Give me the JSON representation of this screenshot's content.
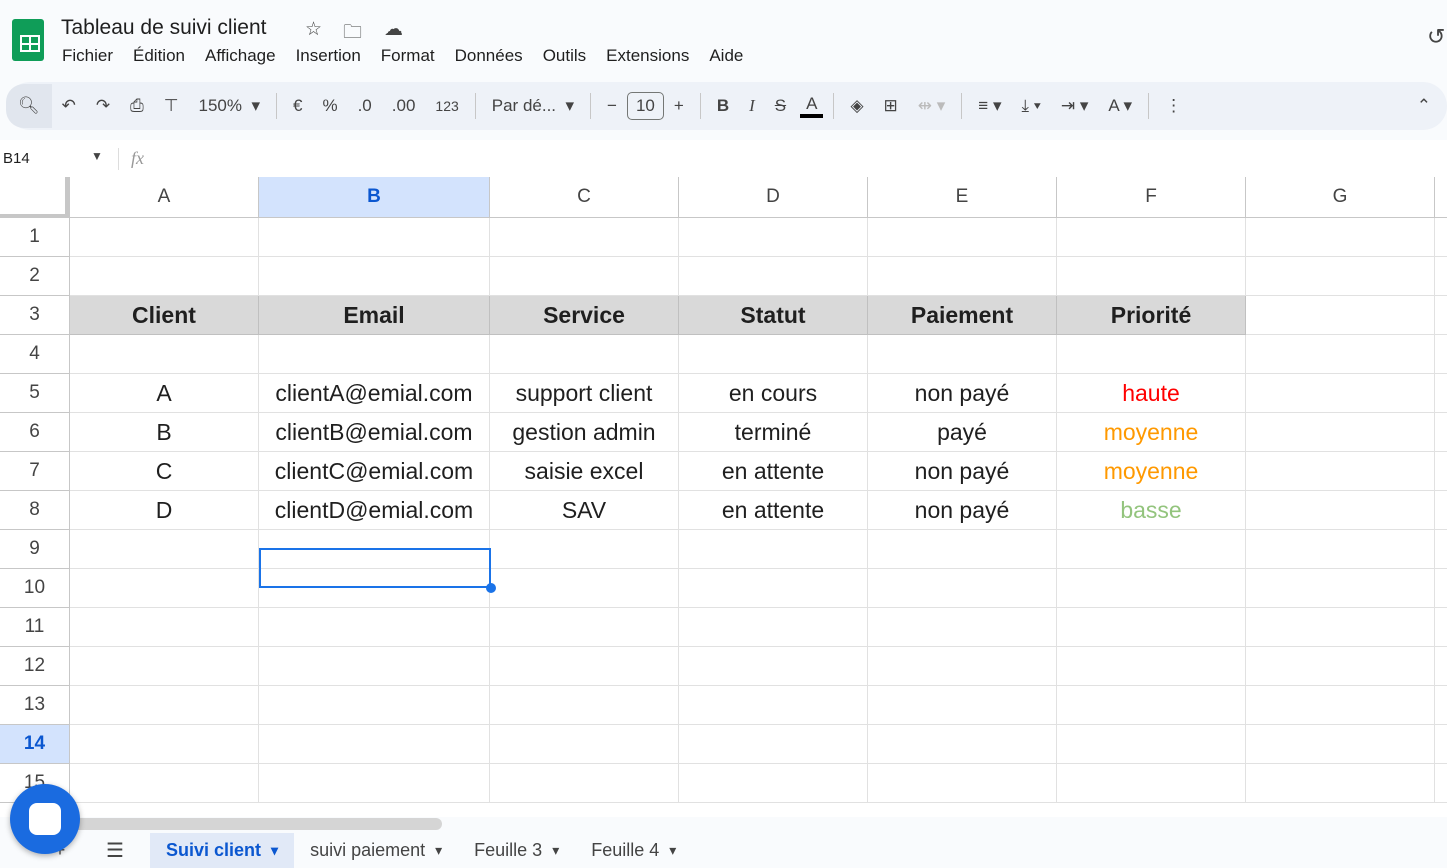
{
  "app": {
    "title": "Tableau de suivi client",
    "menu": [
      "Fichier",
      "Édition",
      "Affichage",
      "Insertion",
      "Format",
      "Données",
      "Outils",
      "Extensions",
      "Aide"
    ]
  },
  "toolbar": {
    "zoom": "150%",
    "font": "Par dé...",
    "font_size": "10",
    "currency": "€",
    "percent": "%",
    "dec_less": ".0",
    "dec_more": ".00",
    "number_format": "123"
  },
  "formula": {
    "cell_ref": "B14",
    "fx": "fx",
    "value": ""
  },
  "columns": [
    "A",
    "B",
    "C",
    "D",
    "E",
    "F",
    "G"
  ],
  "selected": {
    "col": "B",
    "row": 14
  },
  "header_row": {
    "row": 3,
    "cells": [
      "Client",
      "Email",
      "Service",
      "Statut",
      "Paiement",
      "Priorité"
    ]
  },
  "data_rows": [
    {
      "row": 5,
      "cells": [
        "A",
        "clientA@emial.com",
        "support client",
        "en cours",
        "non payé",
        "haute"
      ],
      "priority_color": "#ff0000"
    },
    {
      "row": 6,
      "cells": [
        "B",
        "clientB@emial.com",
        "gestion admin",
        "terminé",
        "payé",
        "moyenne"
      ],
      "priority_color": "#ff9900"
    },
    {
      "row": 7,
      "cells": [
        "C",
        "clientC@emial.com",
        "saisie excel",
        "en attente",
        "non payé",
        "moyenne"
      ],
      "priority_color": "#ff9900"
    },
    {
      "row": 8,
      "cells": [
        "D",
        "clientD@emial.com",
        "SAV",
        "en attente",
        "non payé",
        "basse"
      ],
      "priority_color": "#93c47d"
    }
  ],
  "row_numbers": [
    "1",
    "2",
    "3",
    "4",
    "5",
    "6",
    "7",
    "8",
    "9",
    "10",
    "11",
    "12",
    "13",
    "14",
    "15"
  ],
  "sheets": [
    {
      "name": "Suivi client",
      "active": true
    },
    {
      "name": "suivi paiement"
    },
    {
      "name": "Feuille 3"
    },
    {
      "name": "Feuille 4"
    }
  ],
  "colors": {
    "accent": "#1a73e8",
    "header_fill": "#d9d9d9"
  }
}
